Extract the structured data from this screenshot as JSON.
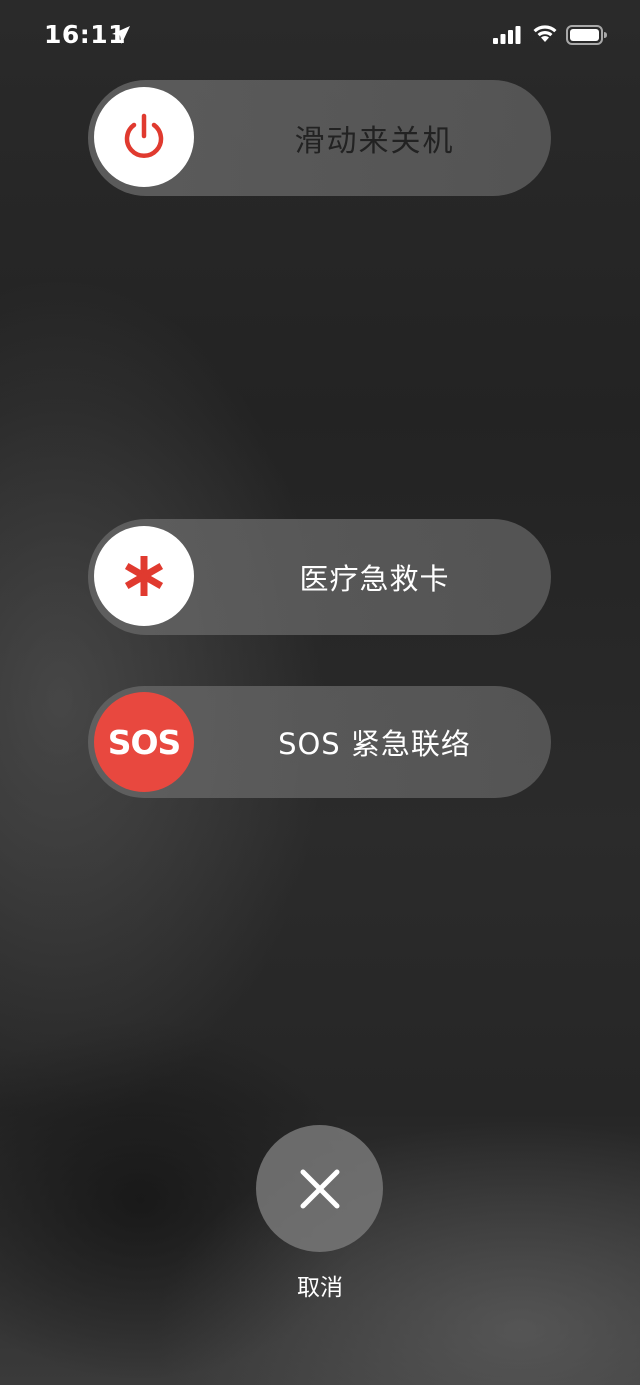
{
  "status_bar": {
    "time": "16:11",
    "icons": [
      "location-arrow-icon",
      "cellular-signal-icon",
      "wifi-icon",
      "battery-icon"
    ]
  },
  "power_slider": {
    "label": "滑动来关机",
    "icon": "power-icon",
    "accent": "#e03a2f"
  },
  "medical_slider": {
    "label": "医疗急救卡",
    "icon": "asterisk-icon",
    "accent": "#e03a2f"
  },
  "sos_slider": {
    "label": "SOS 紧急联络",
    "knob_text": "SOS",
    "accent": "#e8483f"
  },
  "cancel": {
    "label": "取消",
    "icon": "close-icon"
  }
}
